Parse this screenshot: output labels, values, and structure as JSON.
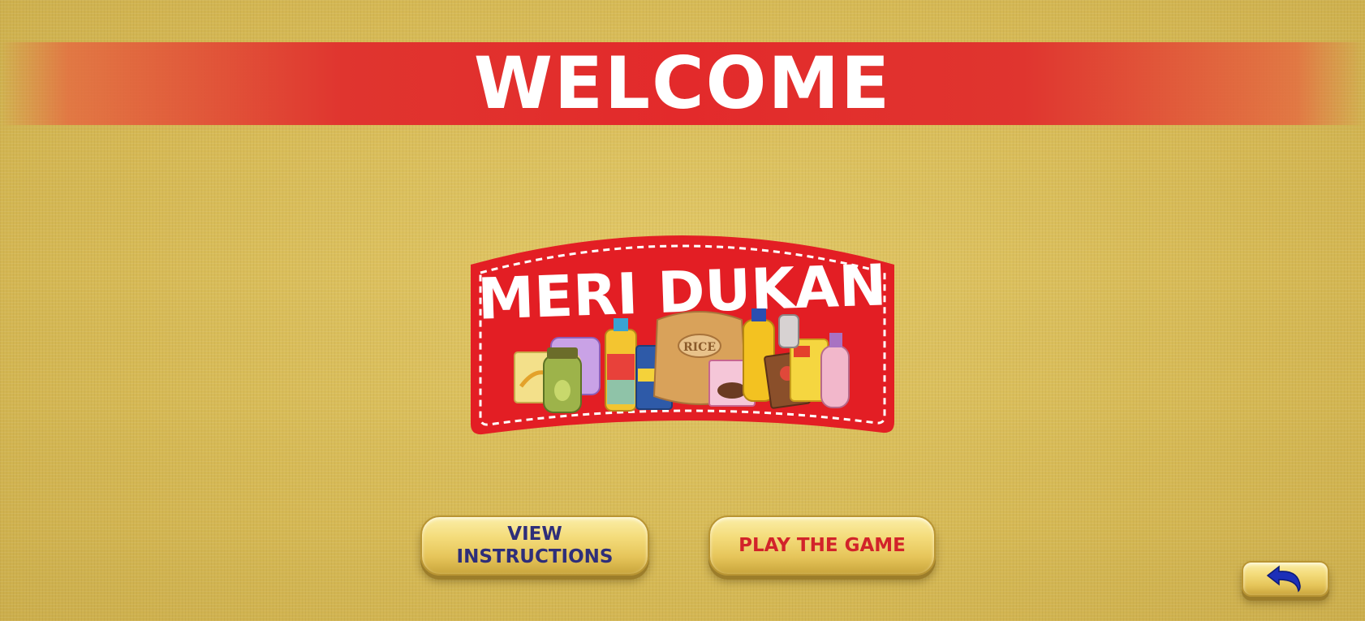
{
  "header": {
    "title": "WELCOME"
  },
  "logo": {
    "title": "MERI DUKAN",
    "badge_text": "RICE",
    "colors": {
      "badge_red": "#e31e24",
      "stitch": "#ffffff",
      "text": "#ffffff"
    }
  },
  "buttons": {
    "instructions_label": "VIEW\nINSTRUCTIONS",
    "play_label": "PLAY THE GAME",
    "back_icon": "undo-arrow-icon"
  },
  "colors": {
    "background": "#d9bd5c",
    "banner": "#e32a2b",
    "instructions_text": "#2e2e7a",
    "play_text": "#d2232a",
    "back_arrow": "#1c2fb8"
  }
}
